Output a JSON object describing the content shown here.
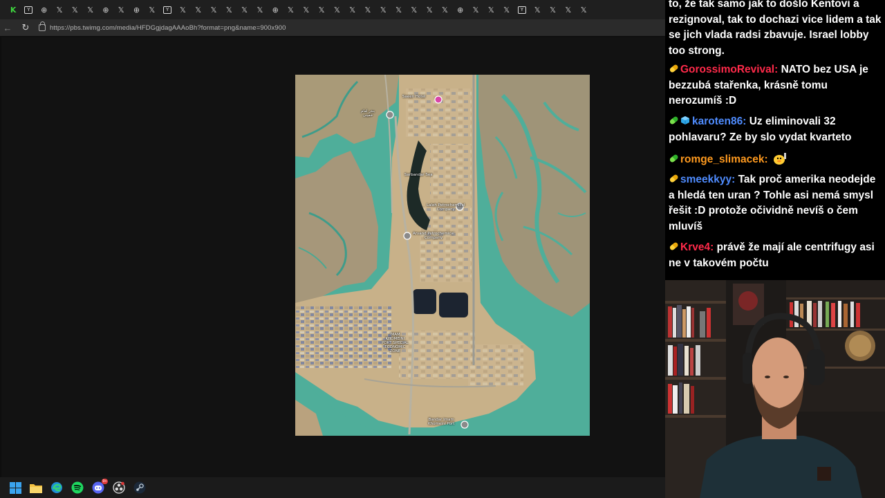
{
  "browser": {
    "tabs": [
      "K",
      "Y",
      "⊕",
      "𝕏",
      "𝕏",
      "𝕏",
      "⊕",
      "𝕏",
      "⊕",
      "𝕏",
      "Y",
      "𝕏",
      "𝕏",
      "𝕏",
      "𝕏",
      "𝕏",
      "𝕏",
      "⊕",
      "𝕏",
      "𝕏",
      "𝕏",
      "𝕏",
      "𝕏",
      "𝕏",
      "𝕏",
      "𝕏",
      "𝕏",
      "𝕏",
      "𝕏",
      "⊕",
      "𝕏",
      "𝕏",
      "𝕏",
      "Y",
      "𝕏",
      "𝕏",
      "𝕏",
      "𝕏"
    ],
    "url": "https://pbs.twimg.com/media/HFDGgjdagAAAoBh?format=png&name=900x900"
  },
  "map_labels": {
    "label_a": "Saeen Hotel",
    "label_b": "بندر امام\nخمینی",
    "label_c": "Sarbandar Sea",
    "label_d": "Laleh Petrochemical\nCompany",
    "label_e": "Arvand Petrochemical\nCompany",
    "label_f": "IMAM\nKHOMEINI\nPORT SPECIAL\nECONOMIC\nZONE",
    "label_g": "Bandar Imam\nKhomeini Port"
  },
  "taskbar": {
    "discord_badge": "9+"
  },
  "chat": {
    "messages": [
      {
        "user": "",
        "text": "to, že tak samo jak to došlo Kentovi a rezignoval, tak to dochazi vice lidem a tak se jich vlada radsi zbavuje. Israel lobby too strong.",
        "color": "#ffffff"
      },
      {
        "user": "GorossimoRevival:",
        "text": "NATO bez USA je bezzubá stařenka, krásně tomu nerozumíš :D",
        "color": "#ff2a4a"
      },
      {
        "user": "karoten86:",
        "text": "Uz eliminovali 32 pohlavaru? Ze by slo vydat kvarteto",
        "color": "#4f8cff"
      },
      {
        "user": "romge_slimacek:",
        "text": "",
        "color": "#ff9a1f"
      },
      {
        "user": "smeekkyy:",
        "text": "Tak proč amerika neodejde a hledá ten uran ? Tohle asi nemá smysl řešit :D protože očividně nevíš o čem mluvíš",
        "color": "#4f8cff"
      },
      {
        "user": "Krve4:",
        "text": "právě že mají ale centrifugy asi ne v takovém počtu",
        "color": "#ff2a4a"
      }
    ]
  },
  "colors": {
    "chat_bg": "#000000",
    "browser_bg": "#121212",
    "sea": "#4fae9a",
    "land": "#c7ae84"
  }
}
